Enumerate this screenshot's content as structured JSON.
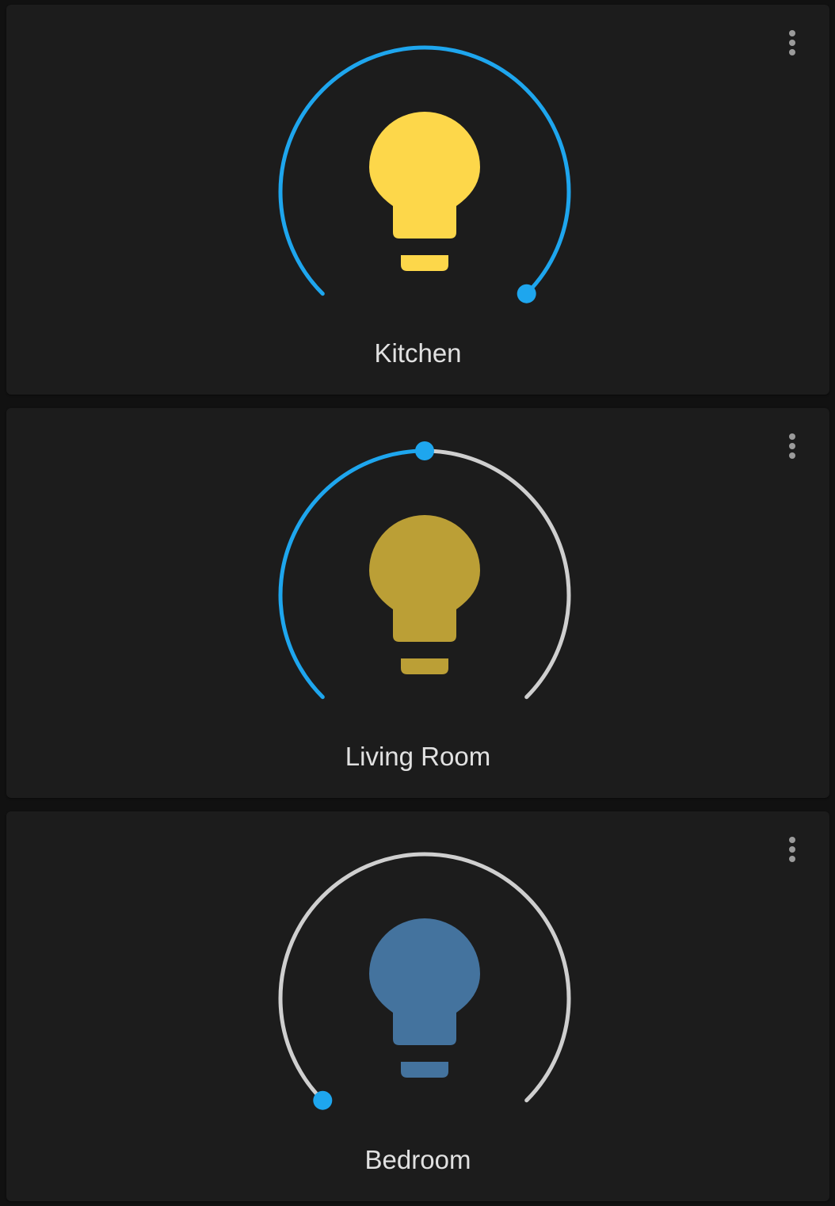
{
  "colors": {
    "accent": "#1ea6ee",
    "track": "#cfcfcf",
    "card_bg": "#1c1c1c",
    "page_bg": "#111111",
    "text": "#e1e1e1",
    "menu_icon": "#9b9b9b"
  },
  "cards": [
    {
      "name": "Kitchen",
      "brightness": 1.0,
      "bulb_color": "#fdd74a",
      "icon": "lightbulb-icon",
      "menu_icon": "more-vertical-icon"
    },
    {
      "name": "Living Room",
      "brightness": 0.5,
      "bulb_color": "#bb9f36",
      "icon": "lightbulb-icon",
      "menu_icon": "more-vertical-icon"
    },
    {
      "name": "Bedroom",
      "brightness": 0.0,
      "bulb_color": "#44739e",
      "icon": "lightbulb-icon",
      "menu_icon": "more-vertical-icon"
    }
  ]
}
